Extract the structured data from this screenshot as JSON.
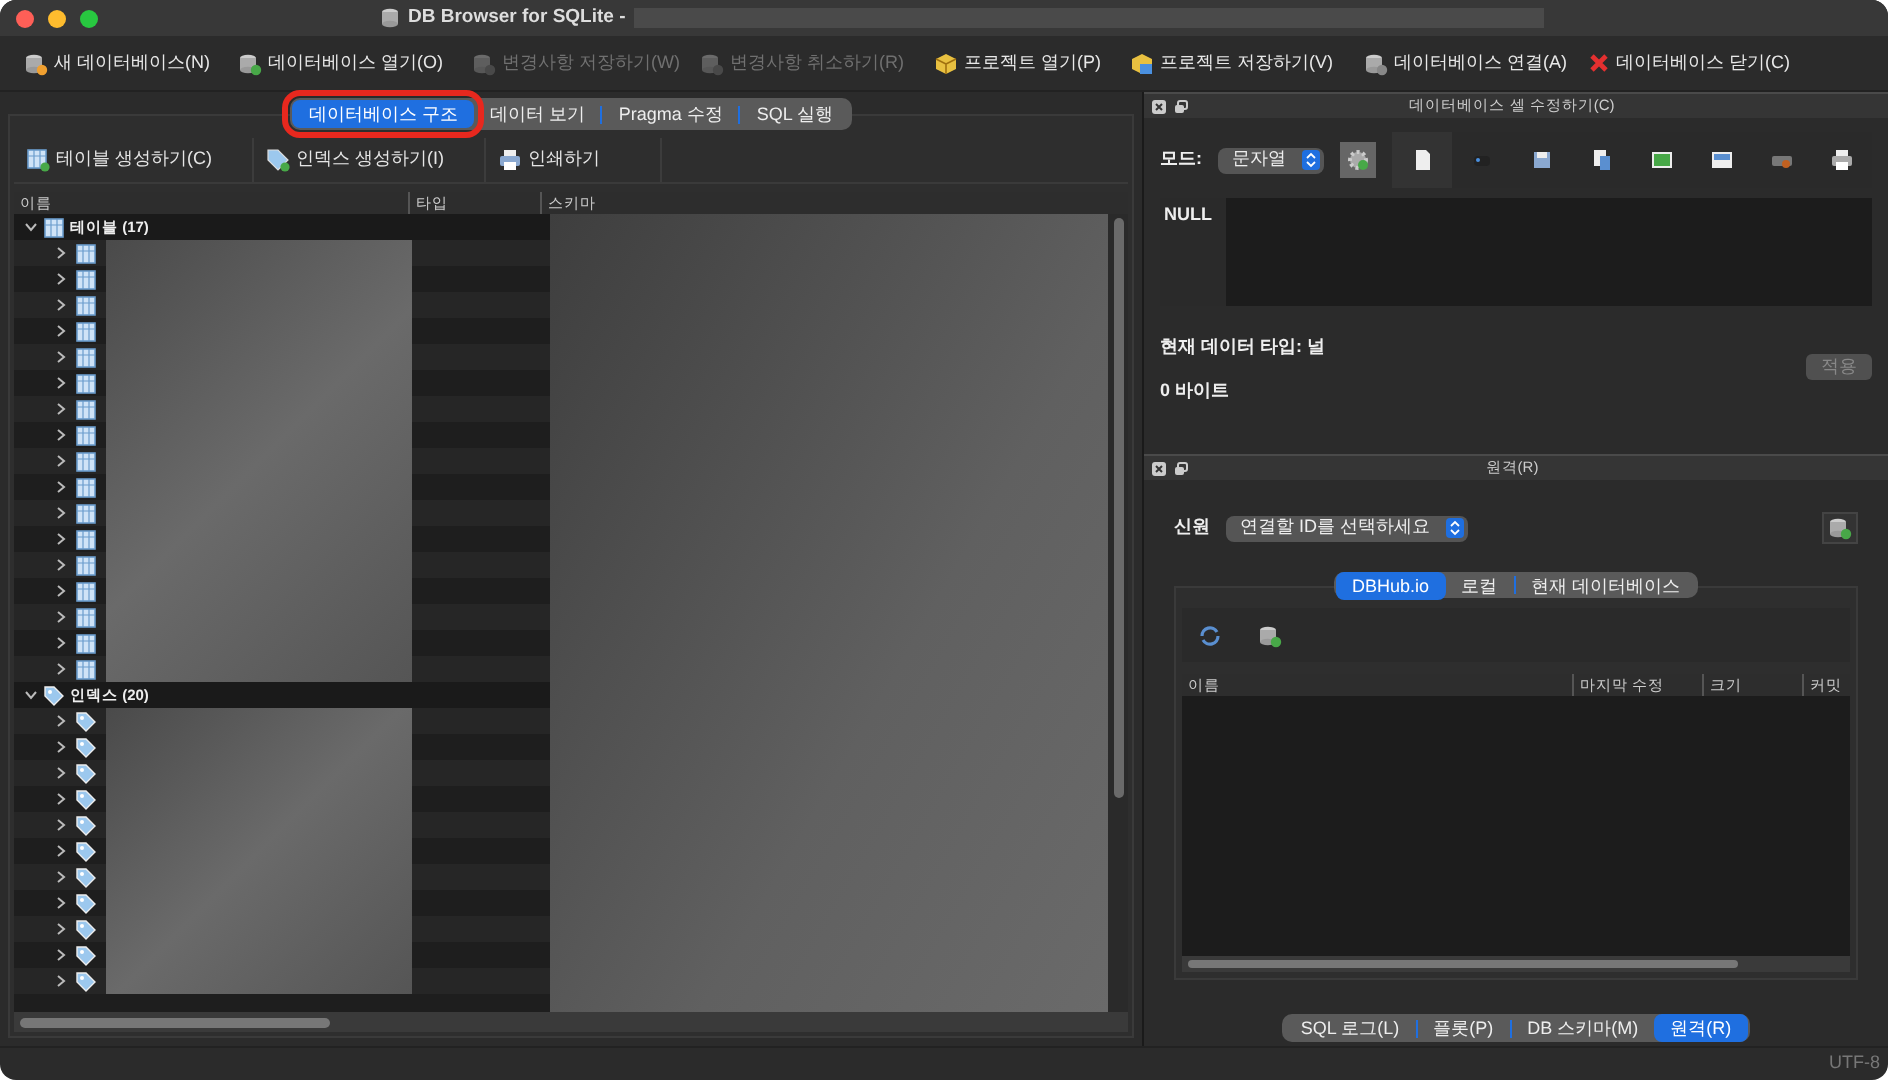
{
  "window": {
    "title": "DB Browser for SQLite -"
  },
  "toolbar": [
    {
      "label": "새 데이터베이스(N)",
      "disabled": false
    },
    {
      "label": "데이터베이스 열기(O)",
      "disabled": false
    },
    {
      "label": "변경사항 저장하기(W)",
      "disabled": true
    },
    {
      "label": "변경사항 취소하기(R)",
      "disabled": true
    },
    {
      "label": "프로젝트 열기(P)",
      "disabled": false
    },
    {
      "label": "프로젝트 저장하기(V)",
      "disabled": false
    },
    {
      "label": "데이터베이스 연결(A)",
      "disabled": false
    },
    {
      "label": "데이터베이스 닫기(C)",
      "disabled": false
    }
  ],
  "main_tabs": [
    {
      "label": "데이터베이스 구조",
      "selected": true,
      "highlighted": true
    },
    {
      "label": "데이터 보기",
      "selected": false,
      "highlighted": false
    },
    {
      "label": "Pragma 수정",
      "selected": false,
      "highlighted": false
    },
    {
      "label": "SQL 실행",
      "selected": false,
      "highlighted": false
    }
  ],
  "structure_toolbar": [
    "테이블 생성하기(C)",
    "인덱스 생성하기(I)",
    "인쇄하기"
  ],
  "tree": {
    "columns": [
      "이름",
      "타입",
      "스키마"
    ],
    "groups": [
      {
        "kind": "table",
        "label": "테이블 (17)",
        "expanded": true,
        "children": [
          {
            "expanded": false
          },
          {
            "expanded": false
          },
          {
            "expanded": false
          },
          {
            "expanded": false
          },
          {
            "expanded": false
          },
          {
            "expanded": false
          },
          {
            "expanded": false
          },
          {
            "expanded": false
          },
          {
            "expanded": false
          },
          {
            "expanded": false
          },
          {
            "expanded": false
          },
          {
            "expanded": false
          },
          {
            "expanded": false
          },
          {
            "expanded": false
          },
          {
            "expanded": false
          },
          {
            "expanded": false
          },
          {
            "expanded": false
          }
        ]
      },
      {
        "kind": "index",
        "label": "인덱스 (20)",
        "expanded": true,
        "children": [
          {
            "expanded": false
          },
          {
            "expanded": false
          },
          {
            "expanded": false
          },
          {
            "expanded": false
          },
          {
            "expanded": false
          },
          {
            "expanded": false
          },
          {
            "expanded": false
          },
          {
            "expanded": false
          },
          {
            "expanded": false
          },
          {
            "expanded": false
          },
          {
            "expanded": false
          }
        ]
      }
    ]
  },
  "cell_editor": {
    "title": "데이터베이스 셀 수정하기(C)",
    "mode_label": "모드:",
    "mode_value": "문자열",
    "null_text": "NULL",
    "type_text": "현재 데이터 타입: 널",
    "size_text": "0 바이트",
    "apply_button": "적용"
  },
  "remote": {
    "title": "원격(R)",
    "identity_label": "신원",
    "identity_value": "연결할 ID를 선택하세요",
    "tabs": [
      {
        "label": "DBHub.io",
        "selected": true
      },
      {
        "label": "로컬",
        "selected": false
      },
      {
        "label": "현재 데이터베이스",
        "selected": false
      }
    ],
    "columns": [
      "이름",
      "마지막 수정",
      "크기",
      "커밋"
    ]
  },
  "bottom_tabs": [
    {
      "label": "SQL 로그(L)",
      "selected": false
    },
    {
      "label": "플롯(P)",
      "selected": false
    },
    {
      "label": "DB 스키마(M)",
      "selected": false
    },
    {
      "label": "원격(R)",
      "selected": true
    }
  ],
  "status_bar": {
    "encoding": "UTF-8"
  }
}
